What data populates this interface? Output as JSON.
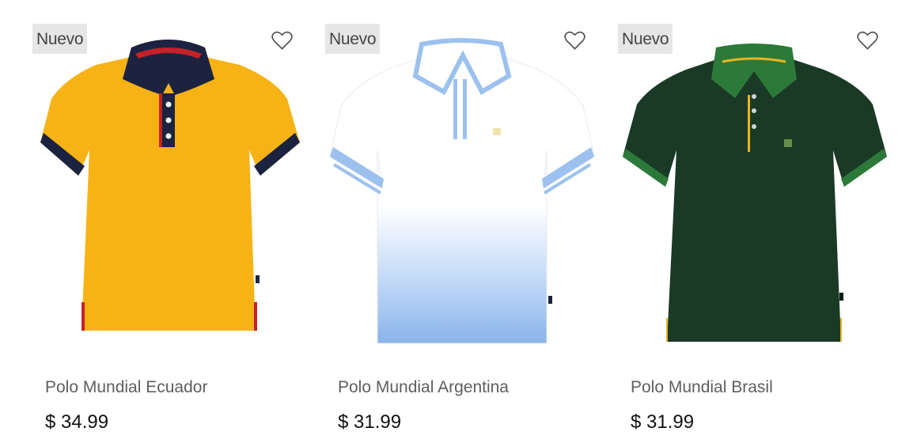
{
  "products": [
    {
      "badge": "Nuevo",
      "name": "Polo Mundial Ecuador",
      "price": "$ 34.99",
      "image_icon": "polo-shirt-image",
      "colors": {
        "body": "#f7b316",
        "collar": "#1b2340",
        "trim": "#c4212a"
      }
    },
    {
      "badge": "Nuevo",
      "name": "Polo Mundial Argentina",
      "price": "$ 31.99",
      "image_icon": "polo-shirt-image",
      "colors": {
        "body": "#ffffff",
        "collar": "#9cc1ee",
        "trim": "#8ab4ea"
      }
    },
    {
      "badge": "Nuevo",
      "name": "Polo Mundial Brasil",
      "price": "$ 31.99",
      "image_icon": "polo-shirt-image",
      "colors": {
        "body": "#1b3a26",
        "collar": "#2c7a3a",
        "trim": "#e8b422"
      }
    }
  ],
  "favorite_icon": "heart-outline-icon"
}
